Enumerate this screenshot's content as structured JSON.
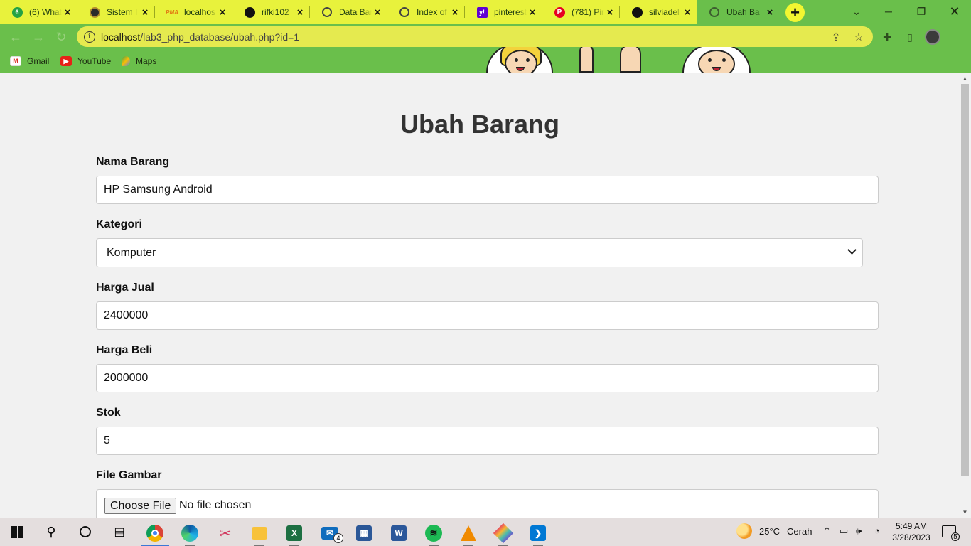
{
  "browser": {
    "tabs": [
      {
        "title": "(6) What",
        "favicon": "whatsapp-icon",
        "active": false
      },
      {
        "title": "Sistem I",
        "favicon": "university-icon",
        "active": false
      },
      {
        "title": "localhos",
        "favicon": "phpmyadmin-icon",
        "active": false
      },
      {
        "title": "rifki102",
        "favicon": "github-icon",
        "active": false
      },
      {
        "title": "Data Bar",
        "favicon": "globe-icon",
        "active": false
      },
      {
        "title": "Index of",
        "favicon": "globe-icon",
        "active": false
      },
      {
        "title": "pinterest",
        "favicon": "yahoo-icon",
        "active": false
      },
      {
        "title": "(781) Pin",
        "favicon": "pinterest-icon",
        "active": false
      },
      {
        "title": "silviadel",
        "favicon": "github-icon",
        "active": false
      },
      {
        "title": "Ubah Ba",
        "favicon": "globe-icon",
        "active": true
      }
    ],
    "address": {
      "host": "localhost",
      "path": "/lab3_php_database/ubah.php?id=1"
    },
    "bookmarks": [
      {
        "label": "Gmail",
        "icon": "gmail-icon"
      },
      {
        "label": "YouTube",
        "icon": "youtube-icon"
      },
      {
        "label": "Maps",
        "icon": "maps-icon"
      }
    ],
    "theme_color": "#6abf4b",
    "tab_color": "#e8f23c"
  },
  "page": {
    "title": "Ubah Barang",
    "fields": {
      "nama_barang": {
        "label": "Nama Barang",
        "value": "HP Samsung Android"
      },
      "kategori": {
        "label": "Kategori",
        "selected": "Komputer"
      },
      "harga_jual": {
        "label": "Harga Jual",
        "value": "2400000"
      },
      "harga_beli": {
        "label": "Harga Beli",
        "value": "2000000"
      },
      "stok": {
        "label": "Stok",
        "value": "5"
      },
      "file_gambar": {
        "label": "File Gambar",
        "button": "Choose File",
        "status": "No file chosen"
      }
    }
  },
  "taskbar": {
    "apps": [
      "windows-start-icon",
      "search-icon",
      "cortana-icon",
      "task-view-icon",
      "chrome-icon",
      "edge-icon",
      "snipping-tool-icon",
      "file-explorer-icon",
      "excel-icon",
      "mail-icon",
      "store-icon",
      "word-icon",
      "spotify-icon",
      "vlc-icon",
      "paint-icon",
      "vscode-icon"
    ],
    "mail_badge": "4",
    "weather": {
      "temp": "25°C",
      "desc": "Cerah"
    },
    "clock": {
      "time": "5:49 AM",
      "date": "3/28/2023"
    },
    "notifications": "5"
  }
}
